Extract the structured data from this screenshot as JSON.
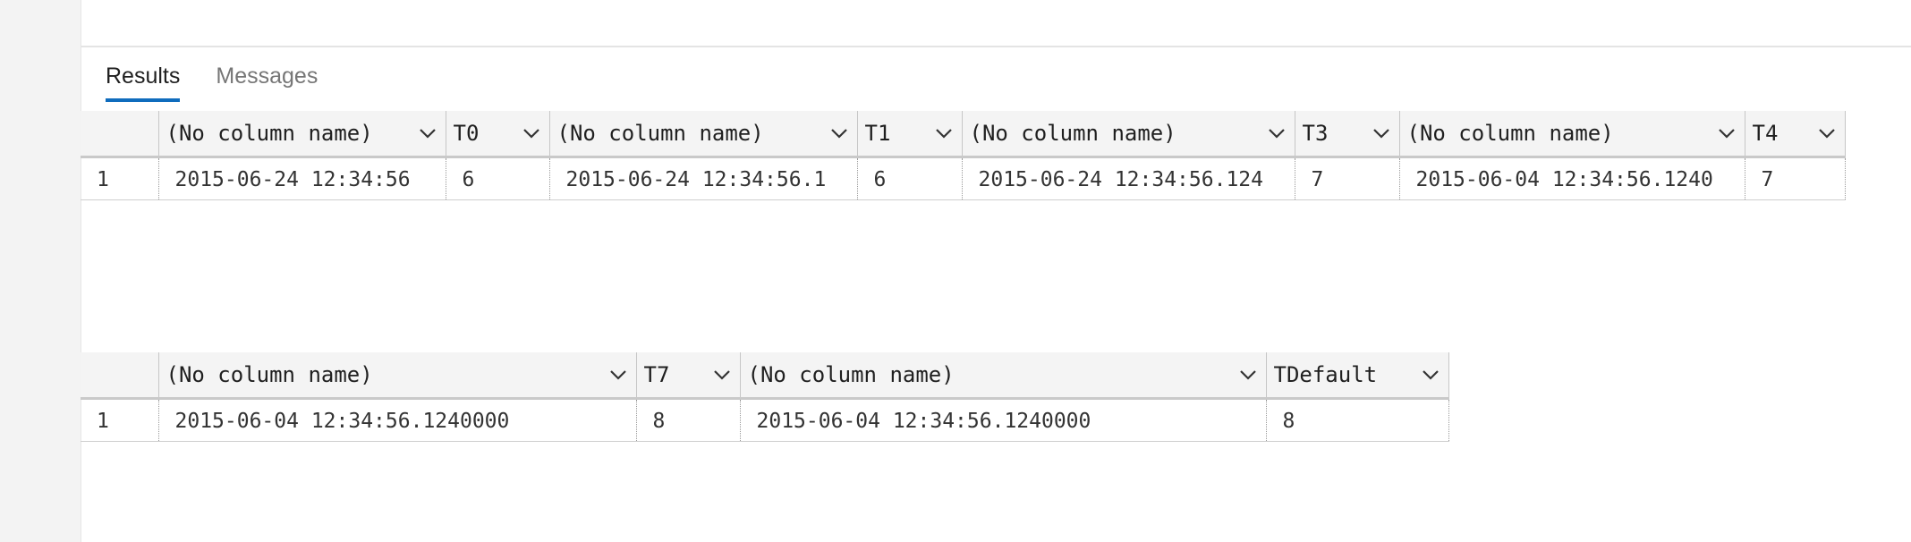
{
  "tabs": [
    {
      "label": "Results",
      "active": true
    },
    {
      "label": "Messages",
      "active": false
    }
  ],
  "grid1": {
    "columns": [
      "(No column name)",
      "T0",
      "(No column name)",
      "T1",
      "(No column name)",
      "T3",
      "(No column name)",
      "T4"
    ],
    "rows": [
      {
        "num": "1",
        "cells": [
          "2015-06-24 12:34:56",
          "6",
          "2015-06-24 12:34:56.1",
          "6",
          "2015-06-24 12:34:56.124",
          "7",
          "2015-06-04 12:34:56.1240",
          "7"
        ]
      }
    ]
  },
  "grid2": {
    "columns": [
      "(No column name)",
      "T7",
      "(No column name)",
      "TDefault"
    ],
    "rows": [
      {
        "num": "1",
        "cells": [
          "2015-06-04 12:34:56.1240000",
          "8",
          "2015-06-04 12:34:56.1240000",
          "8"
        ]
      }
    ]
  },
  "colors": {
    "accent": "#0f6cbd",
    "header_bg": "#f4f4f4",
    "gutter_bg": "#f3f3f3"
  },
  "icons": {
    "column_menu": "chevron-down-icon"
  }
}
